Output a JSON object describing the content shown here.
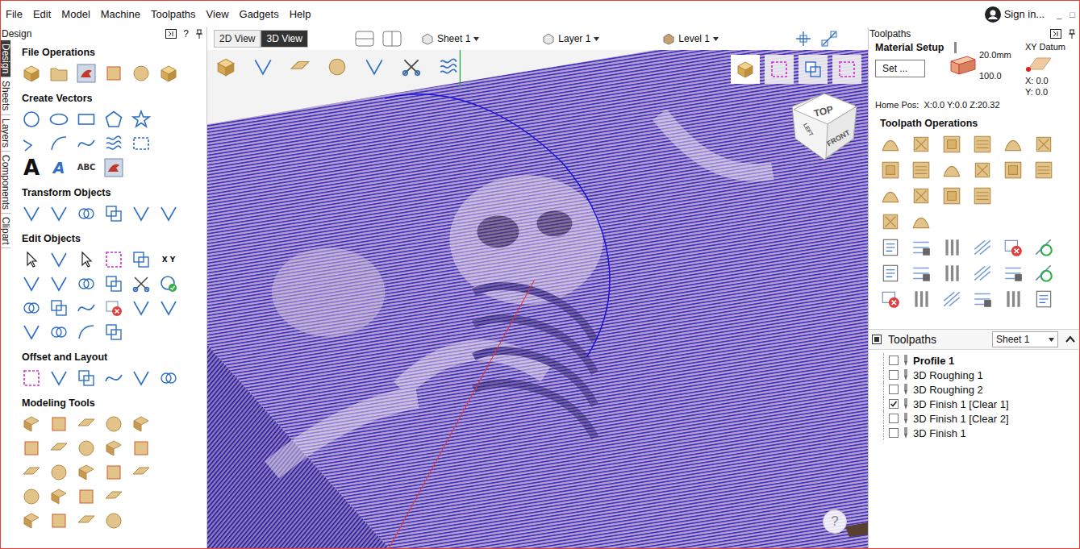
{
  "window": {
    "menu": [
      "File",
      "Edit",
      "Model",
      "Machine",
      "Toolpaths",
      "View",
      "Gadgets",
      "Help"
    ],
    "account": "Sign in...",
    "window_buttons": [
      "_",
      "□"
    ]
  },
  "design_panel": {
    "title": "Design",
    "help": "?",
    "side_tabs": [
      {
        "label": "Design",
        "selected": true
      },
      {
        "label": "Sheets",
        "selected": false
      },
      {
        "label": "Layers",
        "selected": false
      },
      {
        "label": "Components",
        "selected": false
      },
      {
        "label": "Clipart",
        "selected": false
      }
    ],
    "sections": [
      {
        "title": "File Operations",
        "icon_texts": []
      },
      {
        "title": "Create Vectors",
        "icon_texts": [
          "A",
          "A",
          "ABC"
        ]
      },
      {
        "title": "Transform Objects",
        "icon_texts": []
      },
      {
        "title": "Edit Objects",
        "icon_texts": [
          "X Y"
        ]
      },
      {
        "title": "Offset and Layout",
        "icon_texts": []
      },
      {
        "title": "Modeling Tools",
        "icon_texts": []
      }
    ]
  },
  "view_bar": {
    "tabs": [
      {
        "label": "2D View",
        "selected": false
      },
      {
        "label": "3D View",
        "selected": true
      }
    ],
    "selectors": [
      "Sheet 1",
      "Layer 1",
      "Level 1"
    ]
  },
  "view_cube": {
    "top": "TOP",
    "front": "FRONT",
    "left": "LEFT"
  },
  "canvas_help": "?",
  "toolpaths_panel": {
    "title": "Toolpaths",
    "material": {
      "title": "Material Setup",
      "button": "Set ...",
      "thickness": "20.0mm",
      "offset": "100.0",
      "datum_title": "XY Datum",
      "x": "X: 0.0",
      "y": "Y: 0.0",
      "home": "Home Pos:  X:0.0 Y:0.0 Z:20.32"
    },
    "operations_title": "Toolpath Operations",
    "list": {
      "title": "Toolpaths",
      "sheet": "Sheet 1",
      "items": [
        {
          "label": "Profile 1",
          "checked": false,
          "selected": true
        },
        {
          "label": "3D Roughing 1",
          "checked": false,
          "selected": false
        },
        {
          "label": "3D Roughing 2",
          "checked": false,
          "selected": false
        },
        {
          "label": "3D Finish 1 [Clear 1]",
          "checked": true,
          "selected": false
        },
        {
          "label": "3D Finish 1 [Clear 2]",
          "checked": false,
          "selected": false
        },
        {
          "label": "3D Finish 1",
          "checked": false,
          "selected": false
        }
      ]
    }
  }
}
